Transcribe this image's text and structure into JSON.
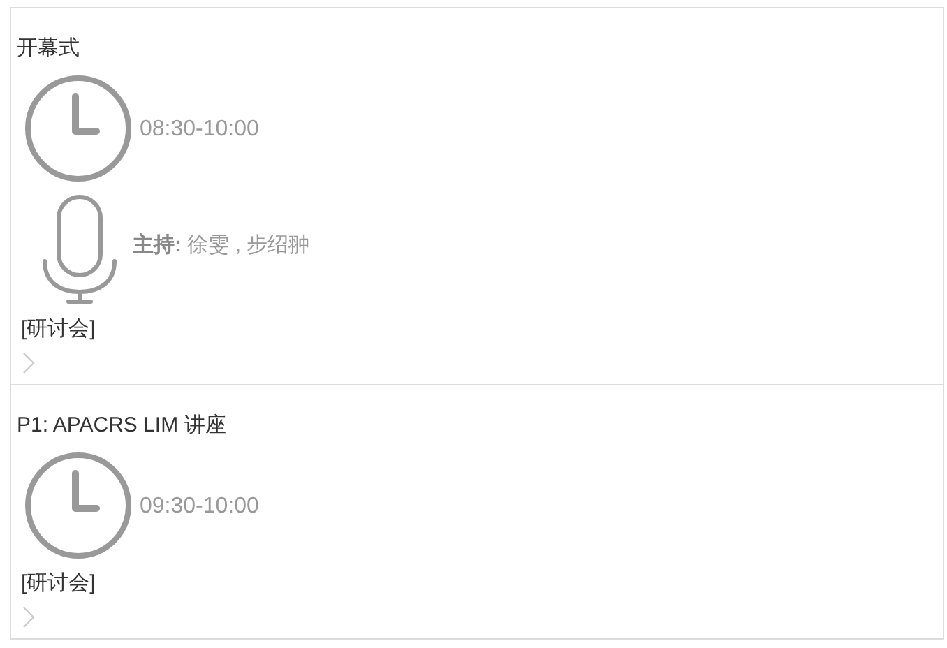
{
  "sessions": [
    {
      "title": "开幕式",
      "time": "08:30-10:00",
      "host": "**主持:** 徐雯 , 步绍翀",
      "tag": "[研讨会]"
    },
    {
      "title": "P1: APACRS LIM 讲座",
      "time": "09:30-10:00",
      "tag": "[研讨会]"
    }
  ]
}
